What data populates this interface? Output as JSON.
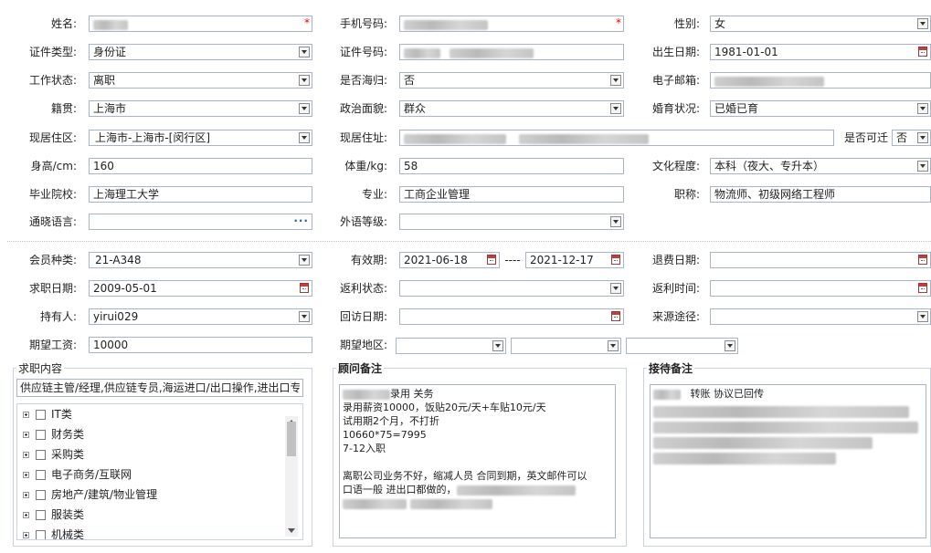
{
  "form": {
    "name": {
      "label": "姓名:",
      "required": "*"
    },
    "mobile": {
      "label": "手机号码:",
      "required": "*"
    },
    "gender": {
      "label": "性别:",
      "value": "女"
    },
    "id_type": {
      "label": "证件类型:",
      "value": "身份证"
    },
    "id_number": {
      "label": "证件号码:"
    },
    "birth_date": {
      "label": "出生日期:",
      "value": "1981-01-01"
    },
    "work_status": {
      "label": "工作状态:",
      "value": "离职"
    },
    "returnee": {
      "label": "是否海归:",
      "value": "否"
    },
    "email": {
      "label": "电子邮箱:"
    },
    "native_place": {
      "label": "籍贯:",
      "value": "上海市"
    },
    "political": {
      "label": "政治面貌:",
      "value": "群众"
    },
    "marital": {
      "label": "婚育状况:",
      "value": "已婚已育"
    },
    "residence_area": {
      "label": "现居住区:",
      "value": "上海市-上海市-[闵行区]"
    },
    "address": {
      "label": "现居住址:"
    },
    "relocate": {
      "label": "是否可迁",
      "value": "否"
    },
    "height": {
      "label": "身高/cm:",
      "value": "160"
    },
    "weight": {
      "label": "体重/kg:",
      "value": "58"
    },
    "education": {
      "label": "文化程度:",
      "value": "本科（夜大、专升本）"
    },
    "school": {
      "label": "毕业院校:",
      "value": "上海理工大学"
    },
    "major": {
      "label": "专业:",
      "value": "工商企业管理"
    },
    "title": {
      "label": "职称:",
      "value": "物流师、初级网络工程师"
    },
    "language": {
      "label": "通晓语言:",
      "more": "···"
    },
    "foreign_level": {
      "label": "外语等级:",
      "value": ""
    }
  },
  "member": {
    "member_type": {
      "label": "会员种类:",
      "value": "21-A348"
    },
    "valid_period": {
      "label": "有效期:",
      "start": "2021-06-18",
      "sep": "----",
      "end": "2021-12-17"
    },
    "refund_date": {
      "label": "退费日期:",
      "value": ""
    },
    "job_date": {
      "label": "求职日期:",
      "value": "2009-05-01"
    },
    "rebate_status": {
      "label": "返利状态:",
      "value": ""
    },
    "rebate_time": {
      "label": "返利时间:",
      "value": ""
    },
    "holder": {
      "label": "持有人:",
      "value": "yirui029"
    },
    "visit_date": {
      "label": "回访日期:",
      "value": ""
    },
    "source": {
      "label": "来源途径:",
      "value": ""
    },
    "salary": {
      "label": "期望工资:",
      "value": "10000"
    },
    "region": {
      "label": "期望地区:"
    }
  },
  "job_panel": {
    "title": "求职内容",
    "summary": "供应链主管/经理,供应链专员,海运进口/出口操作,进出口专",
    "categories": [
      "IT类",
      "财务类",
      "采购类",
      "电子商务/互联网",
      "房地产/建筑/物业管理",
      "服装类",
      "机械类"
    ]
  },
  "advisor_panel": {
    "title": "顾问备注",
    "line1_suffix": "录用   关务",
    "lines": [
      "录用薪资10000，饭贴20元/天+车贴10元/天",
      "试用期2个月，不打折",
      "10660*75=7995",
      "7-12入职",
      "",
      "离职公司业务不好，缩减人员 合同到期，英文邮件可以"
    ],
    "line_last_prefix": "口语一般 进出口都做的，"
  },
  "reception_panel": {
    "title": "接待备注",
    "line1": "转账   协议已回传"
  }
}
